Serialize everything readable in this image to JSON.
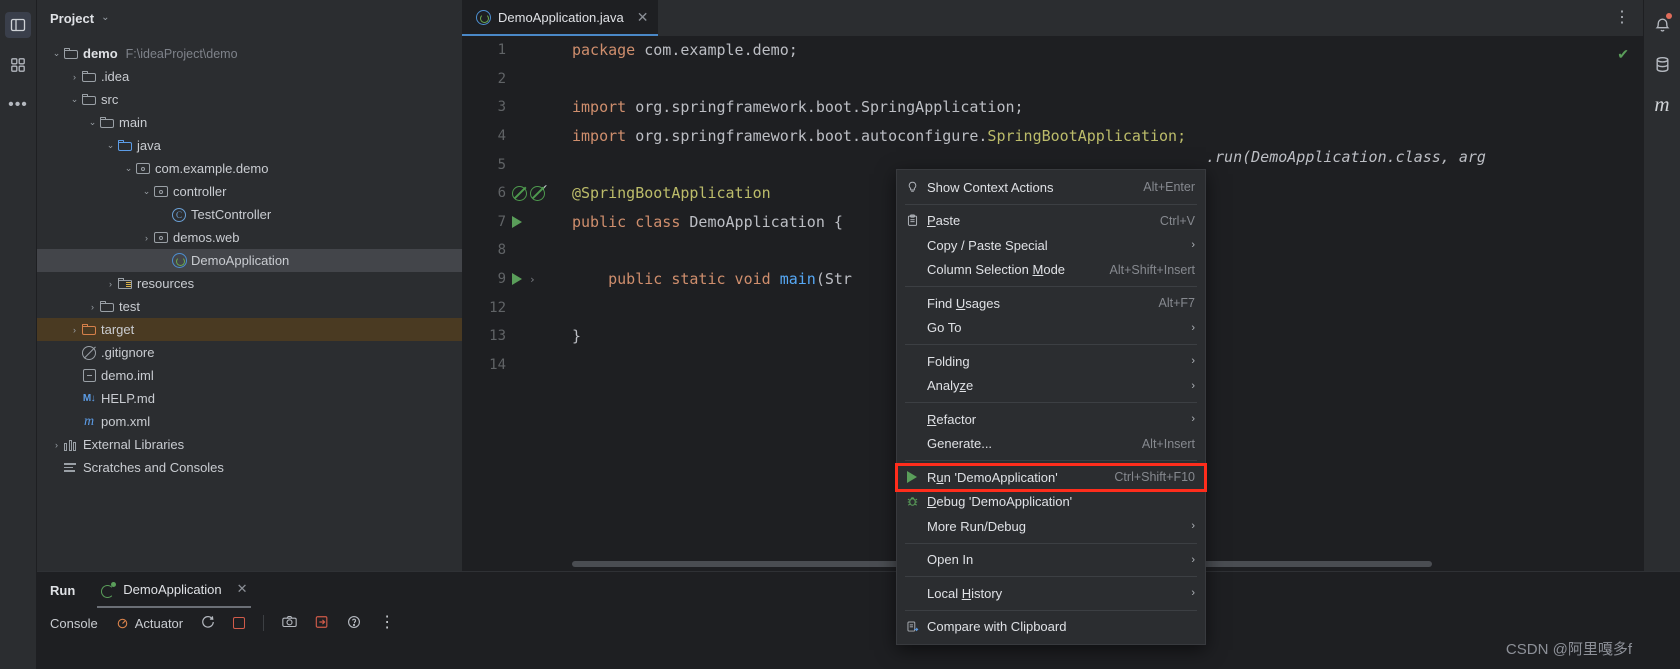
{
  "rail": {
    "buttons": [
      {
        "name": "project-tool-window-icon",
        "label": ""
      },
      {
        "name": "structure-tool-window-icon",
        "label": ""
      },
      {
        "name": "more-tool-windows-icon",
        "label": "…"
      }
    ]
  },
  "right_rail": {
    "buttons": [
      {
        "name": "notifications-icon",
        "label": ""
      },
      {
        "name": "database-icon",
        "label": ""
      },
      {
        "name": "maven-icon",
        "label": "m"
      }
    ]
  },
  "project_panel": {
    "title": "Project",
    "chevron": "⌄",
    "tree": [
      {
        "indent": 0,
        "twist": "⌄",
        "icon": "module-icon",
        "label": "demo",
        "bold": true,
        "path": "F:\\ideaProject\\demo",
        "state": "normal"
      },
      {
        "indent": 1,
        "twist": "›",
        "icon": "folder-icon",
        "label": ".idea",
        "state": "normal"
      },
      {
        "indent": 1,
        "twist": "⌄",
        "icon": "folder-icon",
        "label": "src",
        "state": "normal"
      },
      {
        "indent": 2,
        "twist": "⌄",
        "icon": "folder-icon",
        "label": "main",
        "state": "normal"
      },
      {
        "indent": 3,
        "twist": "⌄",
        "icon": "source-folder-icon",
        "label": "java",
        "state": "normal"
      },
      {
        "indent": 4,
        "twist": "⌄",
        "icon": "package-icon",
        "label": "com.example.demo",
        "state": "normal"
      },
      {
        "indent": 5,
        "twist": "⌄",
        "icon": "package-icon",
        "label": "controller",
        "state": "normal"
      },
      {
        "indent": 6,
        "twist": "",
        "icon": "class-icon",
        "label": "TestController",
        "state": "normal"
      },
      {
        "indent": 5,
        "twist": "›",
        "icon": "package-icon",
        "label": "demos.web",
        "state": "normal"
      },
      {
        "indent": 6,
        "twist": "",
        "icon": "spring-boot-class-icon",
        "label": "DemoApplication",
        "state": "selected"
      },
      {
        "indent": 3,
        "twist": "›",
        "icon": "resources-folder-icon",
        "label": "resources",
        "state": "normal"
      },
      {
        "indent": 2,
        "twist": "›",
        "icon": "folder-icon",
        "label": "test",
        "state": "normal"
      },
      {
        "indent": 1,
        "twist": "›",
        "icon": "excluded-folder-icon",
        "label": "target",
        "state": "target"
      },
      {
        "indent": 1,
        "twist": "",
        "icon": "gitignore-icon",
        "label": ".gitignore",
        "state": "normal"
      },
      {
        "indent": 1,
        "twist": "",
        "icon": "iml-file-icon",
        "label": "demo.iml",
        "state": "normal"
      },
      {
        "indent": 1,
        "twist": "",
        "icon": "markdown-icon",
        "label": "HELP.md",
        "state": "normal"
      },
      {
        "indent": 1,
        "twist": "",
        "icon": "maven-pom-icon",
        "label": "pom.xml",
        "state": "normal"
      },
      {
        "indent": 0,
        "twist": "›",
        "icon": "libraries-icon",
        "label": "External Libraries",
        "state": "normal"
      },
      {
        "indent": 0,
        "twist": "",
        "icon": "scratches-icon",
        "label": "Scratches and Consoles",
        "state": "normal"
      }
    ]
  },
  "editor": {
    "tab": {
      "label": "DemoApplication.java",
      "icon": "spring-boot-class-icon",
      "close": "✕"
    },
    "more_actions": "⋮",
    "inspection_status": "✔",
    "lines": [
      {
        "num": "1",
        "gutter": [],
        "segments": [
          {
            "t": "package ",
            "c": "kw"
          },
          {
            "t": "com.example.demo;",
            "c": "plain"
          }
        ]
      },
      {
        "num": "2",
        "gutter": [],
        "segments": []
      },
      {
        "num": "3",
        "gutter": [],
        "segments": [
          {
            "t": "import ",
            "c": "kw"
          },
          {
            "t": "org.springframework.boot.SpringApplication;",
            "c": "plain"
          }
        ]
      },
      {
        "num": "4",
        "gutter": [],
        "segments": [
          {
            "t": "import ",
            "c": "kw"
          },
          {
            "t": "org.springframework.boot.autoconfigure.",
            "c": "plain"
          },
          {
            "t": "SpringBootApplication;",
            "c": "ann"
          }
        ]
      },
      {
        "num": "5",
        "gutter": [],
        "segments": []
      },
      {
        "num": "6",
        "gutter": [
          "bean",
          "bean-check"
        ],
        "segments": [
          {
            "t": "@SpringBootApplication",
            "c": "ann"
          }
        ]
      },
      {
        "num": "7",
        "gutter": [
          "run"
        ],
        "segments": [
          {
            "t": "public class ",
            "c": "kw"
          },
          {
            "t": "DemoApplication",
            "c": "plain"
          },
          {
            "t": " {",
            "c": "plain"
          }
        ]
      },
      {
        "num": "8",
        "gutter": [],
        "segments": []
      },
      {
        "num": "9",
        "gutter": [
          "run",
          "fold"
        ],
        "segments": [
          {
            "t": "    public static void ",
            "c": "kw"
          },
          {
            "t": "main",
            "c": "blue-id"
          },
          {
            "t": "(Str",
            "c": "plain"
          }
        ]
      },
      {
        "num": "12",
        "gutter": [],
        "segments": []
      },
      {
        "num": "13",
        "gutter": [],
        "segments": [
          {
            "t": "}",
            "c": "plain"
          }
        ]
      },
      {
        "num": "14",
        "gutter": [],
        "segments": []
      }
    ],
    "occluded_code_fragment": ".run(DemoApplication.class, arg"
  },
  "context_menu": {
    "items": [
      {
        "type": "item",
        "icon": "lightbulb-icon",
        "label": "Show Context Actions",
        "shortcut": "Alt+Enter",
        "mnemonic": ""
      },
      {
        "type": "sep"
      },
      {
        "type": "item",
        "icon": "paste-icon",
        "label": "Paste",
        "shortcut": "Ctrl+V",
        "mnemonic": "P"
      },
      {
        "type": "item",
        "icon": "",
        "label": "Copy / Paste Special",
        "shortcut": "",
        "arrow": "›"
      },
      {
        "type": "item",
        "icon": "",
        "label": "Column Selection Mode",
        "shortcut": "Alt+Shift+Insert",
        "mnemonic": "M"
      },
      {
        "type": "sep"
      },
      {
        "type": "item",
        "icon": "",
        "label": "Find Usages",
        "shortcut": "Alt+F7",
        "mnemonic": "U"
      },
      {
        "type": "item",
        "icon": "",
        "label": "Go To",
        "shortcut": "",
        "arrow": "›"
      },
      {
        "type": "sep"
      },
      {
        "type": "item",
        "icon": "",
        "label": "Folding",
        "shortcut": "",
        "arrow": "›"
      },
      {
        "type": "item",
        "icon": "",
        "label": "Analyze",
        "shortcut": "",
        "arrow": "›",
        "mnemonic": "z"
      },
      {
        "type": "sep"
      },
      {
        "type": "item",
        "icon": "",
        "label": "Refactor",
        "shortcut": "",
        "arrow": "›",
        "mnemonic": "R"
      },
      {
        "type": "item",
        "icon": "",
        "label": "Generate...",
        "shortcut": "Alt+Insert",
        "mnemonic": ""
      },
      {
        "type": "sep"
      },
      {
        "type": "item",
        "icon": "run-icon",
        "label": "Run 'DemoApplication'",
        "shortcut": "Ctrl+Shift+F10",
        "mnemonic": "u",
        "highlight": true
      },
      {
        "type": "item",
        "icon": "debug-icon",
        "label": "Debug 'DemoApplication'",
        "shortcut": "",
        "mnemonic": "D"
      },
      {
        "type": "item",
        "icon": "",
        "label": "More Run/Debug",
        "shortcut": "",
        "arrow": "›"
      },
      {
        "type": "sep"
      },
      {
        "type": "item",
        "icon": "",
        "label": "Open In",
        "shortcut": "",
        "arrow": "›"
      },
      {
        "type": "sep"
      },
      {
        "type": "item",
        "icon": "",
        "label": "Local History",
        "shortcut": "",
        "arrow": "›",
        "mnemonic": "H"
      },
      {
        "type": "sep"
      },
      {
        "type": "item",
        "icon": "compare-clipboard-icon",
        "label": "Compare with Clipboard",
        "shortcut": ""
      }
    ],
    "highlight_color": "#ff2d1c"
  },
  "bottom_panel": {
    "title": "Run",
    "tab": {
      "label": "DemoApplication",
      "icon": "spring-run-icon",
      "close": "✕"
    },
    "toolbar": [
      {
        "name": "console-tab",
        "label": "Console"
      },
      {
        "name": "actuator-tab",
        "label": "Actuator"
      },
      {
        "name": "rerun-icon",
        "label": "↻"
      },
      {
        "name": "stop-icon",
        "label": ""
      },
      {
        "name": "camera-icon",
        "label": ""
      },
      {
        "name": "export-icon",
        "label": ""
      },
      {
        "name": "help-icon",
        "label": "?"
      },
      {
        "name": "more-options-icon",
        "label": "⋮"
      }
    ]
  },
  "watermark": "CSDN @阿里嘎多f"
}
